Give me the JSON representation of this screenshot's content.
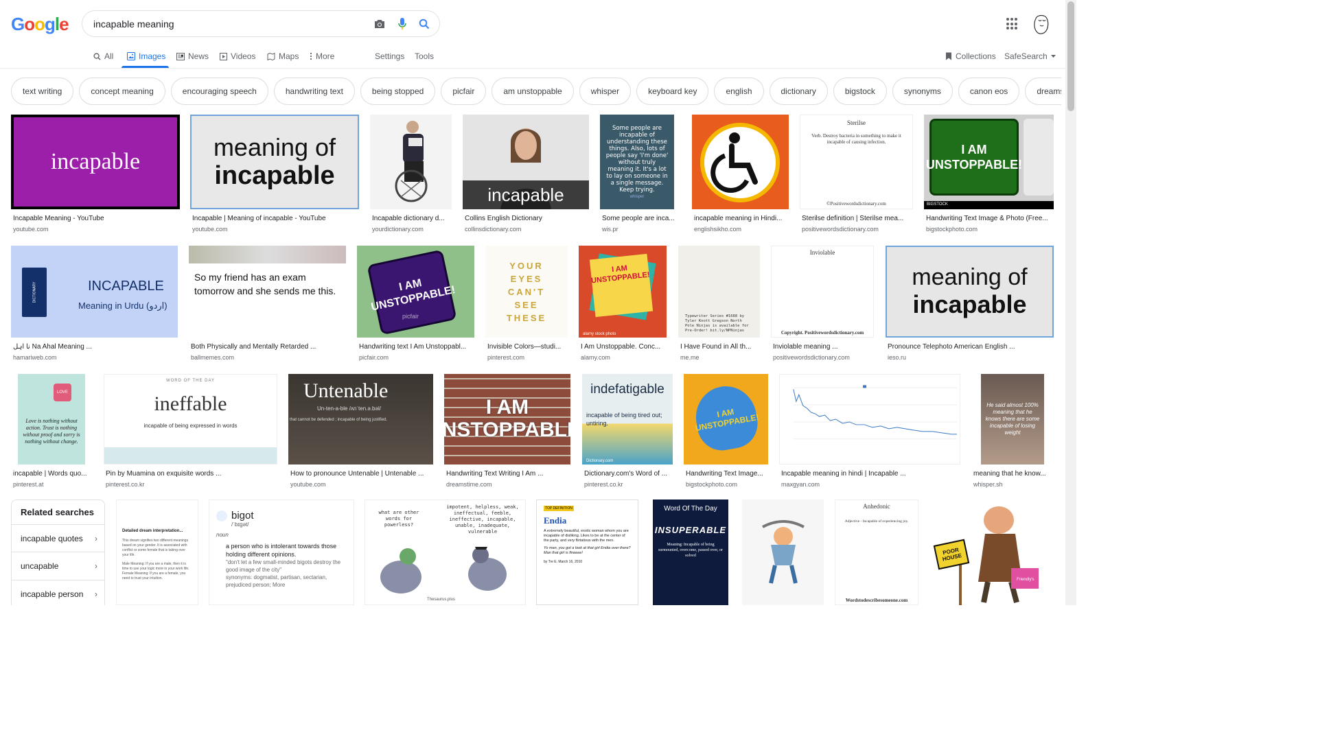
{
  "brand": {
    "logo_letters": [
      "G",
      "o",
      "o",
      "g",
      "l",
      "e"
    ],
    "logo_colors": [
      "#4285f4",
      "#ea4335",
      "#fbbc05",
      "#4285f4",
      "#34a853",
      "#ea4335"
    ]
  },
  "search": {
    "query": "incapable meaning",
    "icons": [
      "camera-icon",
      "mic-icon",
      "search-icon"
    ]
  },
  "nav": {
    "tabs": [
      {
        "label": "All",
        "icon": "search-icon"
      },
      {
        "label": "Images",
        "icon": "image-icon",
        "active": true
      },
      {
        "label": "News",
        "icon": "news-icon"
      },
      {
        "label": "Videos",
        "icon": "video-icon"
      },
      {
        "label": "Maps",
        "icon": "map-icon"
      },
      {
        "label": "More",
        "icon": "more-vert-icon"
      }
    ],
    "settings": "Settings",
    "tools": "Tools",
    "collections": "Collections",
    "safesearch": "SafeSearch"
  },
  "chips": [
    "text writing",
    "concept meaning",
    "encouraging speech",
    "handwriting text",
    "being stopped",
    "picfair",
    "am unstoppable",
    "whisper",
    "keyboard key",
    "english",
    "dictionary",
    "bigstock",
    "synonyms",
    "canon eos",
    "dreamstime"
  ],
  "results": {
    "row1": [
      {
        "title": "Incapable Meaning - YouTube",
        "domain": "youtube.com",
        "thumb_text": "incapable"
      },
      {
        "title": "Incapable | Meaning of incapable - YouTube",
        "domain": "youtube.com",
        "thumb_text": "meaning of",
        "thumb_text2": "incapable"
      },
      {
        "title": "Incapable dictionary d...",
        "domain": "yourdictionary.com"
      },
      {
        "title": "Collins English Dictionary",
        "domain": "collinsdictionary.com",
        "thumb_text": "incapable"
      },
      {
        "title": "Some people are inca...",
        "domain": "wis.pr",
        "thumb_text": "Some people are incapable of understanding these things. Also, lots of people say 'I'm done' without truly meaning it. It's a lot to lay on someone in a single message. Keep trying.",
        "thumb_text2": "whisper"
      },
      {
        "title": "incapable meaning in Hindi...",
        "domain": "englishsikho.com"
      },
      {
        "title": "Sterilse definition | Sterilse mea...",
        "domain": "positivewordsdictionary.com",
        "thumb_text": "Sterilse",
        "thumb_text2": "Verb. Destroy bacteria in something to make it incapable of causing infection.",
        "thumb_text3": "©Positivewordsdictionary.com"
      },
      {
        "title": "Handwriting Text Image & Photo (Free...",
        "domain": "bigstockphoto.com",
        "thumb_text": "I AM UNSTOPPABLE!",
        "thumb_text2": "BIGSTOCK"
      }
    ],
    "row2": [
      {
        "title": "نا اہل Na Ahal Meaning ...",
        "domain": "hamariweb.com",
        "thumb_text": "INCAPABLE",
        "thumb_text2": "Meaning in Urdu (اردو)",
        "thumb_text3": "DICTIONARY"
      },
      {
        "title": "Both Physically and Mentally Retarded ...",
        "domain": "ballmemes.com",
        "thumb_text": "So my friend has an exam tomorrow and she sends me this."
      },
      {
        "title": "Handwriting text I Am Unstoppabl...",
        "domain": "picfair.com",
        "thumb_text": "I AM UNSTOPPABLE!",
        "thumb_text2": "picfair"
      },
      {
        "title": "Invisible Colors—studi...",
        "domain": "pinterest.com",
        "thumb_text": "YOUR EYES CAN'T SEE THESE"
      },
      {
        "title": "I Am Unstoppable. Conc...",
        "domain": "alamy.com",
        "thumb_text": "I AM UNSTOPPABLE!",
        "thumb_text2": "alamy stock photo"
      },
      {
        "title": "I Have Found in All th...",
        "domain": "me.me",
        "thumb_text": "Typewriter Series #1688 by Tyler Knott Gregson North Pole Ninjas is available for Pre-Order! bit.ly/NPNinjas"
      },
      {
        "title": "Inviolable meaning ...",
        "domain": "positivewordsdictionary.com",
        "thumb_text": "Inviolable",
        "thumb_text2": "Copyright. Positivewordsdictionary.com"
      },
      {
        "title": "Pronounce Telephoto American English ...",
        "domain": "ieso.ru",
        "thumb_text": "meaning of",
        "thumb_text2": "incapable"
      }
    ],
    "row3": [
      {
        "title": "incapable | Words quo...",
        "domain": "pinterest.at",
        "thumb_text": "Love is nothing without action. Trust is nothing without proof and sorry is nothing without change.",
        "thumb_text2": "LOVE"
      },
      {
        "title": "Pin by Muamina on exquisite words ...",
        "domain": "pinterest.co.kr",
        "thumb_text": "WORD OF THE DAY",
        "thumb_text2": "ineffable",
        "thumb_text3": "incapable of being expressed in words"
      },
      {
        "title": "How to pronounce Untenable | Untenable ...",
        "domain": "youtube.com",
        "thumb_text": "Untenable",
        "thumb_text2": "Un-ten-a-ble   /ʌnˈten.ə.bəl/",
        "thumb_text3": "that cannot be defended ; incapable of being justified."
      },
      {
        "title": "Handwriting Text Writing I Am ...",
        "domain": "dreamstime.com",
        "thumb_text": "I AM",
        "thumb_text2": "UNSTOPPABLE!"
      },
      {
        "title": "Dictionary.com's Word of ...",
        "domain": "pinterest.co.kr",
        "thumb_text": "indefatigable",
        "thumb_text2": "incapable of being tired out; untiring.",
        "thumb_text3": "Dictionary.com"
      },
      {
        "title": "Handwriting Text Image...",
        "domain": "bigstockphoto.com",
        "thumb_text": "I AM UNSTOPPABLE!"
      },
      {
        "title": "Incapable meaning in hindi | Incapable ...",
        "domain": "maxgyan.com"
      },
      {
        "title": "meaning that he know...",
        "domain": "whisper.sh",
        "thumb_text": "He said almost 100% meaning that he knows there are some incapable of losing weight"
      }
    ],
    "row4": [
      {
        "thumb_text": "Detailed dream interpretation...",
        "thumb_text2": "This dream signifies two different meanings based on your gender. It is associated with conflict or some female that is taking over your life.",
        "thumb_text3": "Male Meaning: If you are a male, then it is time to use your logic more in your work life. Female Meaning: If you are a female, you need to trust your intuition."
      },
      {
        "thumb_text": "bigot",
        "thumb_text2": "/ˈbɪɡət/",
        "thumb_text3": "noun",
        "thumb_text4": "a person who is intolerant towards those holding different opinions.",
        "thumb_text5": "\"don't let a few small-minded bigots destroy the good image of the city\"",
        "thumb_text6": "synonyms: dogmatist, partisan, sectarian, prejudiced person;  More"
      },
      {
        "thumb_text": "what are other words for powerless?",
        "thumb_text2": "impotent, helpless, weak, ineffectual, feeble, ineffective, incapable, unable, inadequate, vulnerable",
        "thumb_text3": "Thesaurus.plus"
      },
      {
        "thumb_text": "TOP DEFINITION",
        "thumb_text2": "Endia",
        "thumb_text3": "A extremely beautiful, exotic woman whom you are incapable of disliking. Likes to be at the center of the party, and very flirtatious with the men.",
        "thumb_text4": "Yo man, you got a look at that girl Endia over there? Man that girl is fineeee!",
        "thumb_text5": "by Tre E. March 16, 2010"
      },
      {
        "thumb_text": "Word Of The Day",
        "thumb_text2": "INSUPERABLE",
        "thumb_text3": "Meaning: Incapable of being surmounted, overcome, passed over, or solved"
      },
      {},
      {
        "thumb_text": "Anhedonic",
        "thumb_text2": "Adjective - Incapable of experiencing joy.",
        "thumb_text3": "Wordstodescribesomeone.com"
      },
      {
        "thumb_text": "POOR HOUSE",
        "thumb_text2": "Friendly's"
      }
    ]
  },
  "related": {
    "title": "Related searches",
    "items": [
      "incapable quotes",
      "uncapable",
      "incapable person"
    ]
  },
  "colors": {
    "accent": "#1a73e8",
    "chip_border": "#dadce0"
  }
}
